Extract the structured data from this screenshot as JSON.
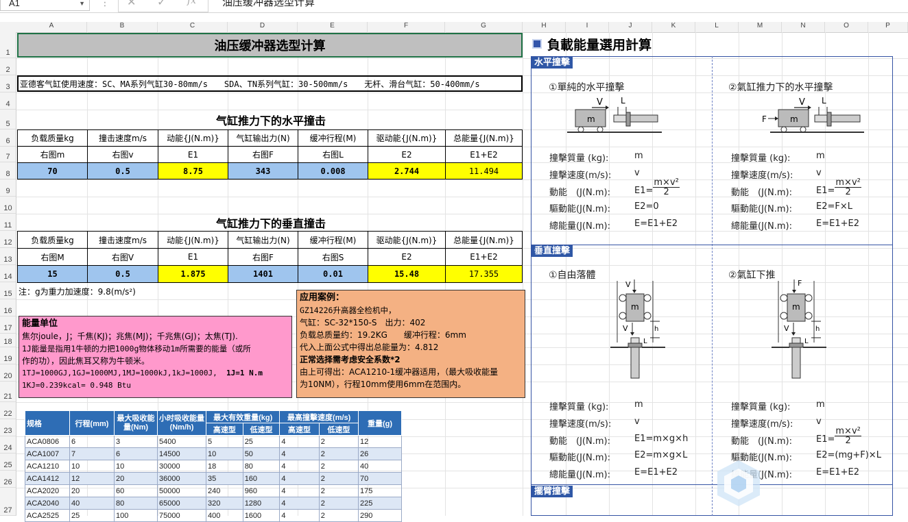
{
  "formula_bar": {
    "name_box": "A1",
    "fx": "fx",
    "content": "油压缓冲器选型计算"
  },
  "columns": [
    "A",
    "B",
    "C",
    "D",
    "E",
    "F",
    "G",
    "H",
    "I",
    "J",
    "K",
    "L",
    "M",
    "N",
    "O",
    "P"
  ],
  "rows": [
    "1",
    "2",
    "3",
    "4",
    "5",
    "6",
    "7",
    "8",
    "9",
    "10",
    "11",
    "12",
    "13",
    "14",
    "15",
    "16",
    "17",
    "18",
    "19",
    "20",
    "21",
    "22",
    "23",
    "24",
    "25",
    "26",
    "27"
  ],
  "sheet": {
    "title": "油压缓冲器选型计算",
    "speed_note": "亚德客气缸使用速度：SC、MA系列气缸30-80mm/s　　SDA、TN系列气缸：30-500mm/s　　无杆、滑台气缸：50-400mm/s",
    "horizontal": {
      "title": "气缸推力下的水平撞击",
      "headers": [
        "负载质量kg",
        "撞击速度m/s",
        "动能{J(N.m)}",
        "气缸输出力(N)",
        "缓冲行程(M)",
        "驱动能{J(N.m)}",
        "总能量{J(N.m)}"
      ],
      "symbols": [
        "右图m",
        "右图v",
        "E1",
        "右图F",
        "右图L",
        "E2",
        "E1+E2"
      ],
      "values": [
        "70",
        "0.5",
        "8.75",
        "343",
        "0.008",
        "2.744",
        "11.494"
      ]
    },
    "vertical": {
      "title": "气缸推力下的垂直撞击",
      "headers": [
        "负载质量kg",
        "撞击速度m/s",
        "动能{J(N.m)}",
        "气缸输出力(N)",
        "缓冲行程(M)",
        "驱动能{J(N.m)}",
        "总能量{J(N.m)}"
      ],
      "symbols": [
        "右图M",
        "右图V",
        "E1",
        "右图F",
        "右图S",
        "E2",
        "E1+E2"
      ],
      "values": [
        "15",
        "0.5",
        "1.875",
        "1401",
        "0.01",
        "15.48",
        "17.355"
      ]
    },
    "gravity_note": "注：g为重力加速度：9.8(m/s²)",
    "energy_units": {
      "title": "能量单位",
      "lines": [
        "焦尔joule，J；千焦(KJ)；兆焦(MJ)；千兆焦(GJ)；太焦(TJ).",
        "1J能量是指用1牛顿的力把1000g物体移动1m所需要的能量（或所",
        "作的功），因此焦耳又称为牛顿米。",
        "1TJ=1000GJ,1GJ=1000MJ,1MJ=1000kJ,1kJ=1000J,",
        "1KJ=0.239kcal= 0.948 Btu"
      ],
      "bold_tail": "1J=1 N.m"
    },
    "case": {
      "title": "应用案例：",
      "lines": [
        "GZ14226升高器全检机中，",
        "气缸：SC-32*150-S　出力：402",
        "负载总质量约：19.2KG　　缓冲行程：6mm",
        "代入上面公式中得出总能量为：4.812"
      ],
      "bold_line": "正常选择需考虑安全系数*2",
      "tail_lines": [
        "由上可得出：ACA1210-1缓冲器适用，（最大吸收能量",
        "为10NM），行程10mm使用6mm在范围内。"
      ]
    },
    "spec_table": {
      "headers": [
        "规格",
        "行程(mm)",
        "最大吸收能量(Nm)",
        "小时吸收能量(Nm/h)",
        "最大有效重量(kg)",
        "最高撞擊速度(m/s)",
        "重量(g)"
      ],
      "sub_headers": [
        "高速型",
        "低速型",
        "高速型",
        "低速型"
      ],
      "rows": [
        [
          "ACA0806",
          "6",
          "3",
          "5400",
          "5",
          "25",
          "4",
          "2",
          "12"
        ],
        [
          "ACA1007",
          "7",
          "6",
          "14500",
          "10",
          "50",
          "4",
          "2",
          "26"
        ],
        [
          "ACA1210",
          "10",
          "10",
          "30000",
          "18",
          "80",
          "4",
          "2",
          "40"
        ],
        [
          "ACA1412",
          "12",
          "20",
          "36000",
          "35",
          "160",
          "4",
          "2",
          "70"
        ],
        [
          "ACA2020",
          "20",
          "60",
          "50000",
          "240",
          "960",
          "4",
          "2",
          "175"
        ],
        [
          "ACA2040",
          "40",
          "80",
          "65000",
          "320",
          "1280",
          "4",
          "2",
          "225"
        ],
        [
          "ACA2525",
          "25",
          "100",
          "75000",
          "400",
          "1600",
          "4",
          "2",
          "290"
        ]
      ]
    }
  },
  "right_panel": {
    "title": "負載能量選用計算",
    "sec_horizontal": "水平撞擊",
    "sec_vertical": "垂直撞擊",
    "sec_swing": "擺臂撞擊",
    "h1": {
      "sub": "①單純的水平撞擊",
      "labels": [
        "撞擊質量 (kg):",
        "撞擊速度(m/s):",
        "動能　(J(N.m):",
        "驅動能(J(N.m):",
        "總能量(J(N.m):"
      ],
      "values": [
        "m",
        "v",
        "E1=",
        "E2=0",
        "E=E1+E2"
      ],
      "frac_num": "m×v²",
      "frac_den": "2"
    },
    "h2": {
      "sub": "②氣缸推力下的水平撞擊",
      "labels": [
        "撞擊質量 (kg):",
        "撞擊速度(m/s):",
        "動能　(J(N.m):",
        "驅動能(J(N.m):",
        "總能量(J(N.m):"
      ],
      "values": [
        "m",
        "v",
        "E1=",
        "E2=F×L",
        "E=E1+E2"
      ],
      "frac_num": "m×v²",
      "frac_den": "2"
    },
    "v1": {
      "sub": "①自由落體",
      "labels": [
        "撞擊質量 (kg):",
        "撞擊速度(m/s):",
        "動能　(J(N.m):",
        "驅動能(J(N.m):",
        "總能量(J(N.m):"
      ],
      "values": [
        "m",
        "v",
        "E1=m×g×h",
        "E2=m×g×L",
        "E=E1+E2"
      ]
    },
    "v2": {
      "sub": "②氣缸下推",
      "labels": [
        "撞擊質量 (kg):",
        "撞擊速度(m/s):",
        "動能　(J(N.m):",
        "驅動能(J(N.m):",
        "總能量(J(N.m):"
      ],
      "values": [
        "m",
        "v",
        "E1=",
        "E2=(mg+F)×L",
        "E=E1+E2"
      ],
      "frac_num": "m×v²",
      "frac_den": "2"
    },
    "diagram_labels": {
      "V": "V",
      "L": "L",
      "F": "F",
      "m": "m",
      "h": "h",
      "v": "v"
    }
  },
  "colors": {
    "header_blue": "#9fc5ee",
    "highlight_yellow": "#ffff00",
    "pink": "#ff99cc",
    "orange": "#f4b183",
    "panel_blue": "#2f57a6",
    "table_blue": "#2e6db5"
  }
}
